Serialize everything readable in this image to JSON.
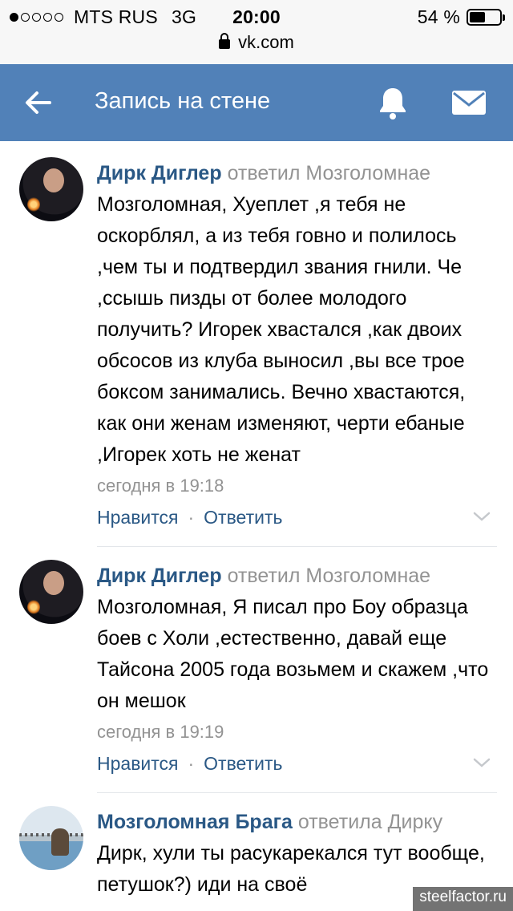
{
  "status_bar": {
    "carrier": "MTS RUS",
    "network": "3G",
    "time": "20:00",
    "battery_text": "54 %",
    "battery_level": 0.54,
    "signal_strength": 1
  },
  "url_bar": {
    "host": "vk.com"
  },
  "header": {
    "title": "Запись на стене",
    "back_icon": "arrow-left-icon",
    "notifications_icon": "bell-icon",
    "messages_icon": "envelope-icon"
  },
  "comments": [
    {
      "author": "Дирк Диглер",
      "reply_to": "ответил Мозголомнае",
      "text": "Мозголомная, Хуеплет ,я тебя не оскорблял, а из тебя говно и полилось ,чем ты и подтвердил звания гнили. Че ,ссышь пизды от более молодого получить? Игорек хвастался ,как двоих обсосов из клуба выносил ,вы все трое боксом занимались. Вечно хвастаются, как они женам изменяют, черти ебаные ,Игорек хоть не женат",
      "date": "сегодня в 19:18",
      "like_label": "Нравится",
      "separator": "·",
      "reply_label": "Ответить"
    },
    {
      "author": "Дирк Диглер",
      "reply_to": "ответил Мозголомнае",
      "text": "Мозголомная, Я писал про Боу образца боев с Холи ,естественно, давай еще Тайсона 2005 года возьмем и скажем ,что он мешок",
      "date": "сегодня в 19:19",
      "like_label": "Нравится",
      "separator": "·",
      "reply_label": "Ответить"
    },
    {
      "author": "Мозголомная Брага",
      "reply_to": "ответила Дирку",
      "text": "Дирк, хули ты расукарекался тут вообще, петушок?) иди на своё",
      "date": "",
      "like_label": "",
      "separator": "",
      "reply_label": ""
    }
  ],
  "watermark": "steelfactor.ru",
  "colors": {
    "header_bg": "#5181b8",
    "link": "#2a5885",
    "muted": "#939393"
  }
}
